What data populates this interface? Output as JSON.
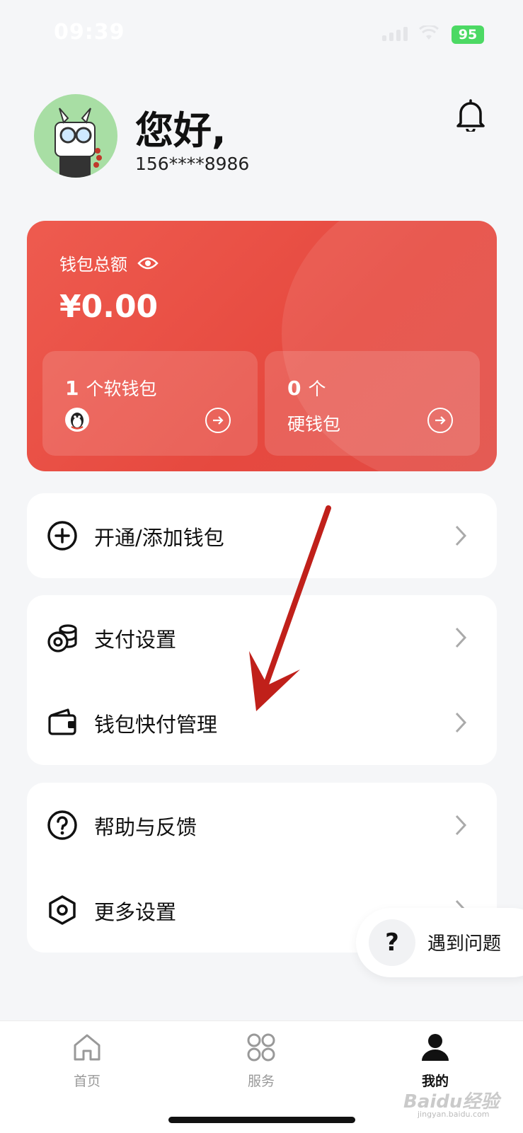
{
  "status_bar": {
    "time": "09:39",
    "battery": "95"
  },
  "header": {
    "greeting": "您好,",
    "phone": "156****8986"
  },
  "wallet": {
    "label": "钱包总额",
    "amount": "¥0.00",
    "soft": {
      "count": "1",
      "text": "个软钱包"
    },
    "hard": {
      "count": "0",
      "unit": "个",
      "text": "硬钱包"
    }
  },
  "menu": {
    "open_wallet": "开通/添加钱包",
    "payment_settings": "支付设置",
    "quick_pay": "钱包快付管理",
    "help_feedback": "帮助与反馈",
    "more_settings": "更多设置"
  },
  "help_float": {
    "icon": "?",
    "label": "遇到问题"
  },
  "tabs": [
    {
      "label": "首页",
      "icon": "home-icon",
      "active": false
    },
    {
      "label": "服务",
      "icon": "grid-icon",
      "active": false
    },
    {
      "label": "我的",
      "icon": "user-icon",
      "active": true
    }
  ],
  "watermark": {
    "brand": "Baidu经验",
    "url": "jingyan.baidu.com"
  },
  "colors": {
    "wallet_red": "#e6493f",
    "annotation_red": "#c0201a",
    "background": "#f5f6f8"
  }
}
